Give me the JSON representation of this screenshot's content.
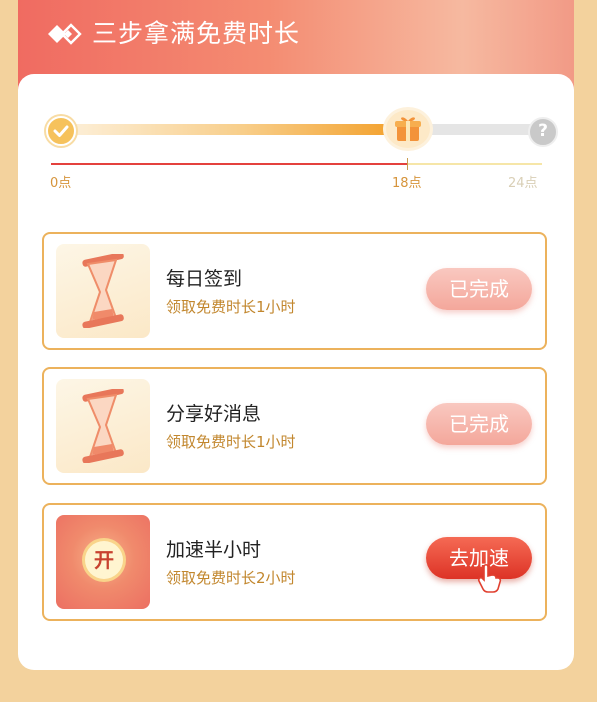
{
  "header": {
    "title": "三步拿满免费时长"
  },
  "progress": {
    "labels": [
      "0点",
      "18点",
      "24点"
    ],
    "help_glyph": "?"
  },
  "tasks": [
    {
      "title": "每日签到",
      "subtitle": "领取免费时长1小时",
      "button": "已完成",
      "status": "completed"
    },
    {
      "title": "分享好消息",
      "subtitle": "领取免费时长1小时",
      "button": "已完成",
      "status": "completed"
    },
    {
      "title": "加速半小时",
      "subtitle": "领取免费时长2小时",
      "button": "去加速",
      "status": "pending",
      "badge": "开"
    }
  ],
  "colors": {
    "header_start": "#f06b61",
    "accent_orange": "#f3a22f",
    "border": "#ecb25c",
    "done_button": "#f4a79b",
    "go_button": "#dd3326",
    "subtitle": "#c2872e"
  },
  "icons": [
    "diamond-icon",
    "check-icon",
    "gift-icon",
    "help-icon",
    "hourglass-icon",
    "hand-pointer-icon"
  ]
}
